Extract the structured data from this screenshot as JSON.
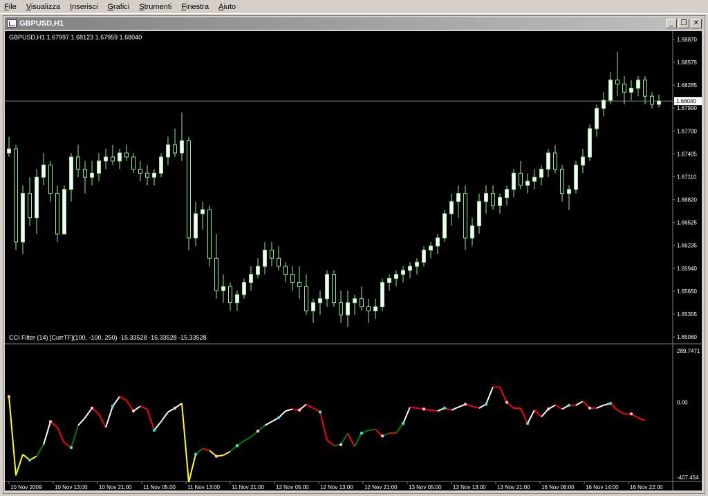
{
  "menu": [
    "File",
    "Visualizza",
    "Inserisci",
    "Grafici",
    "Strumenti",
    "Finestra",
    "Aiuto"
  ],
  "window": {
    "title": "GBPUSD,H1",
    "minimize": "_",
    "restore": "❒",
    "close": "✕"
  },
  "main_chart": {
    "label": "GBPUSD,H1  1.67997 1.68123 1.67959 1.68040",
    "current_price": "1.68040",
    "price_labels": [
      "1.68870",
      "1.68575",
      "1.68285",
      "1.67990",
      "1.67700",
      "1.67405",
      "1.67110",
      "1.66820",
      "1.66525",
      "1.66235",
      "1.65940",
      "1.65650",
      "1.65355",
      "1.65060"
    ]
  },
  "indicator": {
    "label": "CCI Filter (14) [CurrTF](100, -100, 250) -15.33528 -15.33528 -15.33528",
    "max_label": "289.7471",
    "zero_label": "0.00",
    "min_label": "-407.454"
  },
  "time_labels": [
    "10 Nov 2009",
    "10 Nov 13:00",
    "10 Nov 21:00",
    "11 Nov 05:00",
    "11 Nov 13:00",
    "11 Nov 21:00",
    "12 Nov 05:00",
    "12 Nov 13:00",
    "12 Nov 21:00",
    "13 Nov 05:00",
    "13 Nov 13:00",
    "13 Nov 21:00",
    "16 Nov 06:00",
    "16 Nov 14:00",
    "16 Nov 22:00"
  ],
  "colors": {
    "bull": "#ffffff",
    "bear": "#000000",
    "wick": "#90ee90",
    "cci_red": "#ff0000",
    "cci_blue": "#0000ff",
    "cci_white": "#ffffff",
    "cci_yellow": "#ffff00",
    "cci_green": "#008000"
  },
  "chart_data": {
    "type": "candlestick",
    "price_ylim": [
      1.6506,
      1.6887
    ],
    "cci_ylim": [
      -407.454,
      289.7471
    ],
    "candles": [
      [
        1.674,
        1.676,
        1.6735,
        1.6745
      ],
      [
        1.6745,
        1.675,
        1.662,
        1.663
      ],
      [
        1.663,
        1.67,
        1.6615,
        1.669
      ],
      [
        1.669,
        1.671,
        1.665,
        1.666
      ],
      [
        1.666,
        1.672,
        1.664,
        1.671
      ],
      [
        1.671,
        1.674,
        1.67,
        1.6725
      ],
      [
        1.6725,
        1.673,
        1.668,
        1.669
      ],
      [
        1.669,
        1.67,
        1.663,
        1.664
      ],
      [
        1.664,
        1.67,
        1.664,
        1.6695
      ],
      [
        1.6695,
        1.674,
        1.668,
        1.6735
      ],
      [
        1.6735,
        1.675,
        1.671,
        1.672
      ],
      [
        1.672,
        1.673,
        1.669,
        1.671
      ],
      [
        1.671,
        1.673,
        1.67,
        1.6715
      ],
      [
        1.6715,
        1.674,
        1.6705,
        1.673
      ],
      [
        1.673,
        1.6745,
        1.672,
        1.6735
      ],
      [
        1.6735,
        1.675,
        1.6725,
        1.673
      ],
      [
        1.673,
        1.6745,
        1.672,
        1.674
      ],
      [
        1.674,
        1.675,
        1.673,
        1.6735
      ],
      [
        1.6735,
        1.674,
        1.6715,
        1.672
      ],
      [
        1.672,
        1.673,
        1.6705,
        1.6715
      ],
      [
        1.6715,
        1.6725,
        1.67,
        1.671
      ],
      [
        1.671,
        1.672,
        1.67,
        1.6715
      ],
      [
        1.6715,
        1.674,
        1.671,
        1.6735
      ],
      [
        1.6735,
        1.676,
        1.6725,
        1.675
      ],
      [
        1.675,
        1.677,
        1.6735,
        1.674
      ],
      [
        1.674,
        1.679,
        1.673,
        1.6755
      ],
      [
        1.6755,
        1.676,
        1.662,
        1.6635
      ],
      [
        1.6635,
        1.668,
        1.6625,
        1.6665
      ],
      [
        1.6665,
        1.668,
        1.6645,
        1.667
      ],
      [
        1.667,
        1.6675,
        1.66,
        1.661
      ],
      [
        1.661,
        1.664,
        1.656,
        1.657
      ],
      [
        1.657,
        1.659,
        1.6555,
        1.6575
      ],
      [
        1.6575,
        1.658,
        1.6545,
        1.6555
      ],
      [
        1.6555,
        1.657,
        1.6545,
        1.6565
      ],
      [
        1.6565,
        1.6585,
        1.656,
        1.658
      ],
      [
        1.658,
        1.66,
        1.657,
        1.659
      ],
      [
        1.659,
        1.661,
        1.6585,
        1.66
      ],
      [
        1.66,
        1.663,
        1.659,
        1.662
      ],
      [
        1.662,
        1.663,
        1.66,
        1.661
      ],
      [
        1.661,
        1.6625,
        1.6595,
        1.66
      ],
      [
        1.66,
        1.6605,
        1.658,
        1.659
      ],
      [
        1.659,
        1.66,
        1.657,
        1.658
      ],
      [
        1.658,
        1.66,
        1.656,
        1.6575
      ],
      [
        1.6575,
        1.659,
        1.654,
        1.6545
      ],
      [
        1.6545,
        1.656,
        1.653,
        1.6555
      ],
      [
        1.6555,
        1.657,
        1.654,
        1.656
      ],
      [
        1.656,
        1.6595,
        1.655,
        1.659
      ],
      [
        1.659,
        1.6595,
        1.655,
        1.6555
      ],
      [
        1.6555,
        1.657,
        1.653,
        1.654
      ],
      [
        1.654,
        1.657,
        1.6525,
        1.6555
      ],
      [
        1.6555,
        1.6565,
        1.654,
        1.656
      ],
      [
        1.656,
        1.6575,
        1.6545,
        1.655
      ],
      [
        1.655,
        1.656,
        1.653,
        1.6545
      ],
      [
        1.6545,
        1.656,
        1.6535,
        1.655
      ],
      [
        1.655,
        1.6585,
        1.6545,
        1.658
      ],
      [
        1.658,
        1.659,
        1.657,
        1.6585
      ],
      [
        1.6585,
        1.6595,
        1.6575,
        1.659
      ],
      [
        1.659,
        1.66,
        1.658,
        1.6595
      ],
      [
        1.6595,
        1.6605,
        1.6585,
        1.66
      ],
      [
        1.66,
        1.661,
        1.659,
        1.6605
      ],
      [
        1.6605,
        1.6625,
        1.66,
        1.662
      ],
      [
        1.662,
        1.663,
        1.661,
        1.6625
      ],
      [
        1.6625,
        1.664,
        1.6615,
        1.6635
      ],
      [
        1.6635,
        1.667,
        1.663,
        1.6665
      ],
      [
        1.6665,
        1.669,
        1.665,
        1.668
      ],
      [
        1.668,
        1.67,
        1.666,
        1.669
      ],
      [
        1.669,
        1.67,
        1.662,
        1.6635
      ],
      [
        1.6635,
        1.666,
        1.6625,
        1.665
      ],
      [
        1.665,
        1.669,
        1.664,
        1.668
      ],
      [
        1.668,
        1.67,
        1.6665,
        1.669
      ],
      [
        1.669,
        1.67,
        1.667,
        1.6675
      ],
      [
        1.6675,
        1.669,
        1.6665,
        1.6685
      ],
      [
        1.6685,
        1.67,
        1.6675,
        1.6695
      ],
      [
        1.6695,
        1.672,
        1.6685,
        1.6715
      ],
      [
        1.6715,
        1.673,
        1.6695,
        1.67
      ],
      [
        1.67,
        1.6715,
        1.669,
        1.6705
      ],
      [
        1.6705,
        1.672,
        1.6695,
        1.671
      ],
      [
        1.671,
        1.6725,
        1.67,
        1.672
      ],
      [
        1.672,
        1.6745,
        1.671,
        1.674
      ],
      [
        1.674,
        1.675,
        1.6715,
        1.672
      ],
      [
        1.672,
        1.6725,
        1.668,
        1.669
      ],
      [
        1.669,
        1.67,
        1.667,
        1.6695
      ],
      [
        1.6695,
        1.673,
        1.669,
        1.6725
      ],
      [
        1.6725,
        1.6745,
        1.6715,
        1.6735
      ],
      [
        1.6735,
        1.6775,
        1.673,
        1.677
      ],
      [
        1.677,
        1.68,
        1.676,
        1.6795
      ],
      [
        1.6795,
        1.6815,
        1.6785,
        1.6805
      ],
      [
        1.6805,
        1.684,
        1.68,
        1.683
      ],
      [
        1.683,
        1.6865,
        1.681,
        1.6825
      ],
      [
        1.6825,
        1.6835,
        1.68,
        1.6815
      ],
      [
        1.6815,
        1.683,
        1.6805,
        1.682
      ],
      [
        1.682,
        1.6835,
        1.681,
        1.683
      ],
      [
        1.683,
        1.6835,
        1.68,
        1.681
      ],
      [
        1.681,
        1.6815,
        1.6795,
        1.68
      ],
      [
        1.68,
        1.6812,
        1.6796,
        1.6804
      ]
    ],
    "cci": [
      30,
      -380,
      -270,
      -300,
      -280,
      -220,
      -100,
      -130,
      -210,
      -235,
      -120,
      -80,
      -30,
      -60,
      -130,
      -20,
      30,
      10,
      -45,
      -20,
      -35,
      -145,
      -100,
      -50,
      -30,
      -5,
      -415,
      -270,
      -240,
      -250,
      -280,
      -275,
      -255,
      -225,
      -200,
      -180,
      -150,
      -120,
      -100,
      -80,
      -45,
      -35,
      -40,
      -10,
      -30,
      -50,
      -195,
      -225,
      -220,
      -160,
      -230,
      -160,
      -145,
      -140,
      -175,
      -160,
      -160,
      -110,
      -25,
      -30,
      -35,
      -40,
      -45,
      -30,
      -40,
      -25,
      -10,
      -20,
      -30,
      -10,
      80,
      80,
      0,
      -30,
      -30,
      -110,
      -40,
      -75,
      -35,
      -15,
      -35,
      -15,
      -15,
      5,
      -30,
      -30,
      -15,
      -5,
      -40,
      -60,
      -60,
      -80,
      -95
    ],
    "cci_colors_note": "segment colors per picture"
  }
}
